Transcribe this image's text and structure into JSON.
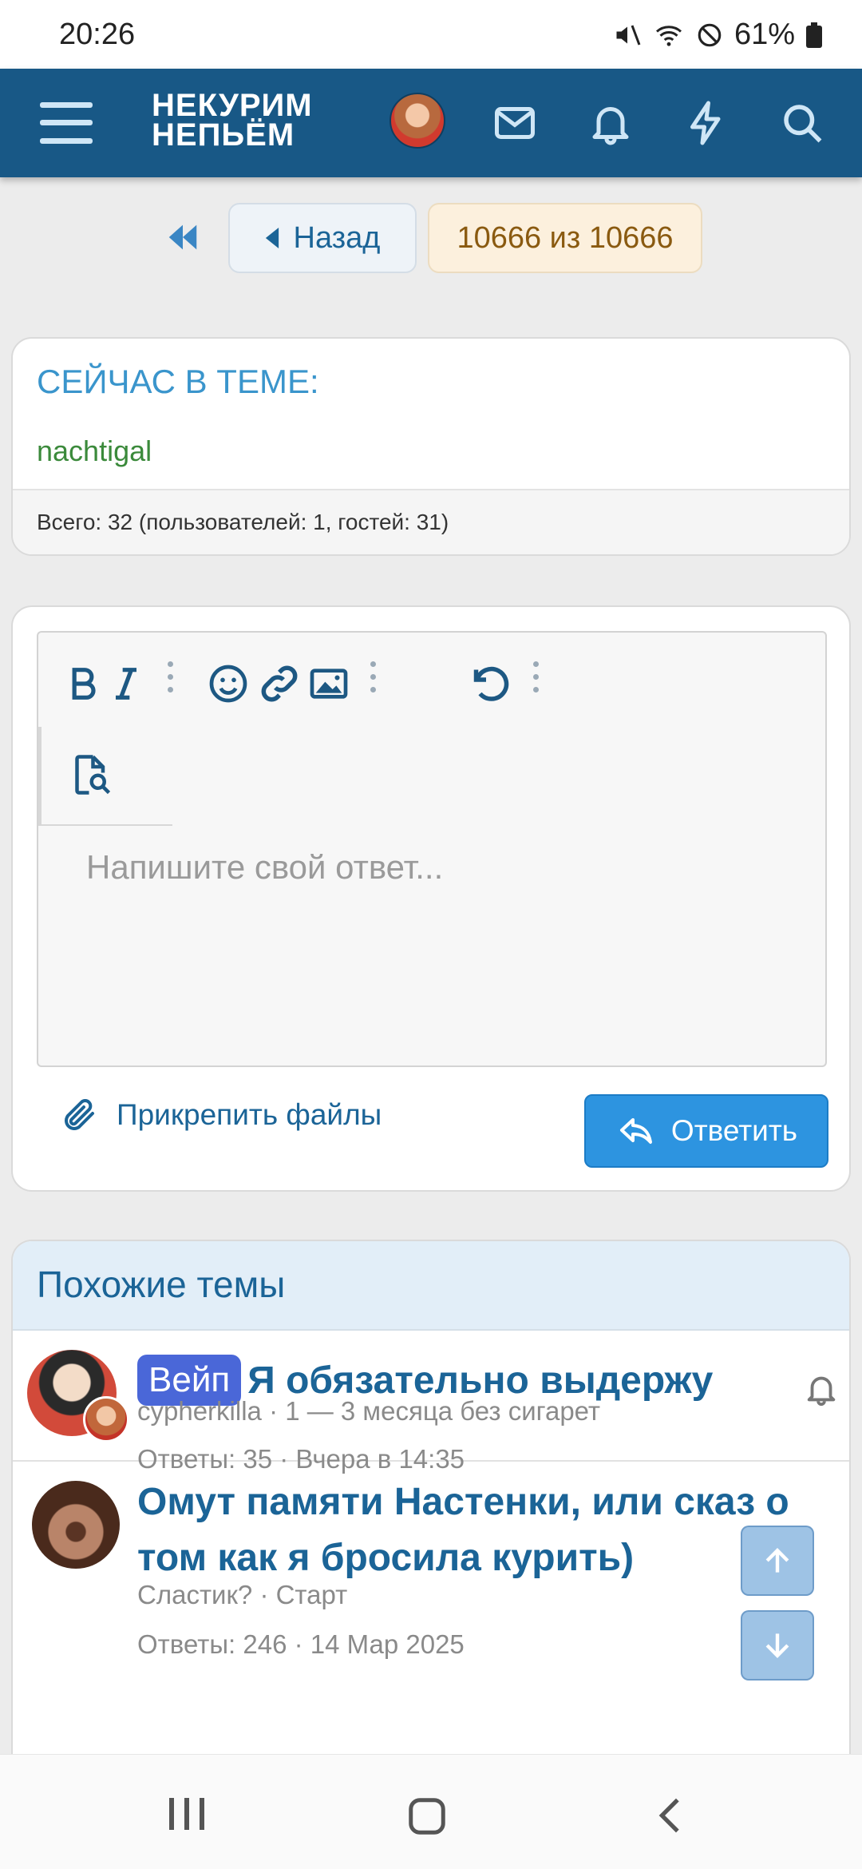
{
  "status_bar": {
    "time": "20:26",
    "battery": "61%"
  },
  "header": {
    "logo_line1": "НЕКУРИМ",
    "logo_line2": "НЕПЬЁМ",
    "icons": [
      "menu-icon",
      "mail-icon",
      "bell-icon",
      "lightning-icon",
      "search-icon"
    ]
  },
  "pagination": {
    "back_label": "Назад",
    "page_count": "10666 из 10666"
  },
  "online": {
    "heading": "СЕЙЧАС В ТЕМЕ:",
    "user": "nachtigal",
    "total": "Всего: 32 (пользователей: 1, гостей: 31)"
  },
  "reply": {
    "placeholder": "Напишите свой ответ...",
    "attach_label": "Прикрепить файлы",
    "submit_label": "Ответить"
  },
  "similar": {
    "title": "Похожие темы",
    "threads": [
      {
        "prefix": "Вейп",
        "title": "Я обязательно выдержу",
        "author_line": "cypherkilla · 1 — 3 месяца без сигарет",
        "stats": "Ответы: 35 · Вчера в 14:35"
      },
      {
        "title_line1": "Омут памяти Настенки, или сказ о",
        "title_line2": "том как я бросила курить)",
        "author_line": "Сластик? · Старт",
        "stats": "Ответы: 246 · 14 Мар 2025"
      }
    ]
  },
  "colors": {
    "header_bg": "#185886",
    "link": "#1b6497",
    "accent": "#2d94e0",
    "prefix_bg": "#4a67d8",
    "online_user": "#3b8a3b"
  }
}
